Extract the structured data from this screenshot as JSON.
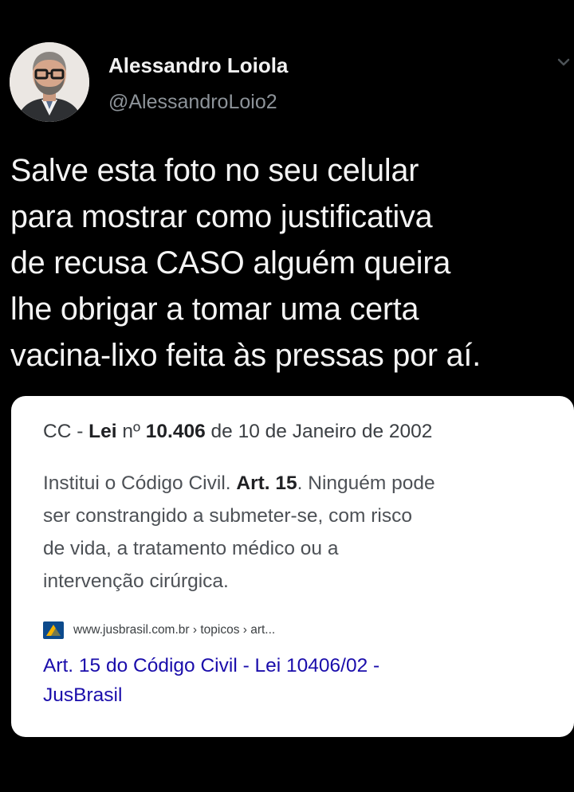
{
  "tweet": {
    "author": {
      "name": "Alessandro Loiola",
      "handle": "@AlessandroLoio2"
    },
    "text_lines": [
      "Salve esta foto no seu celular",
      "para mostrar como justificativa",
      "de recusa CASO alguém queira",
      "lhe obrigar a tomar uma certa",
      "vacina-lixo feita às pressas por aí."
    ]
  },
  "search_card": {
    "header": {
      "prefix": "CC - ",
      "law_word": "Lei",
      "number_label": " nº ",
      "number": "10.406",
      "suffix": " de 10 de Janeiro de 2002"
    },
    "snippet": {
      "line1_start": "Institui o Código Civil. ",
      "article": "Art. 15",
      "line1_end": ". Ninguém pode",
      "lines": [
        "ser constrangido a submeter-se, com risco",
        "de vida, a tratamento médico ou a",
        "intervenção cirúrgica."
      ]
    },
    "source": {
      "url": "www.jusbrasil.com.br › topicos › art..."
    },
    "title_lines": [
      "Art. 15 do Código Civil - Lei 10406/02 -",
      "JusBrasil"
    ]
  },
  "colors": {
    "background": "#000000",
    "tweet_text": "#f4f4f4",
    "handle": "#8d9399",
    "card_background": "#ffffff",
    "link": "#1a0dab",
    "favicon_blue": "#0c4a8c",
    "favicon_yellow": "#f5b300"
  },
  "icons": {
    "avatar": "profile-photo",
    "menu": "chevron-down-icon",
    "favicon": "jusbrasil-favicon"
  }
}
